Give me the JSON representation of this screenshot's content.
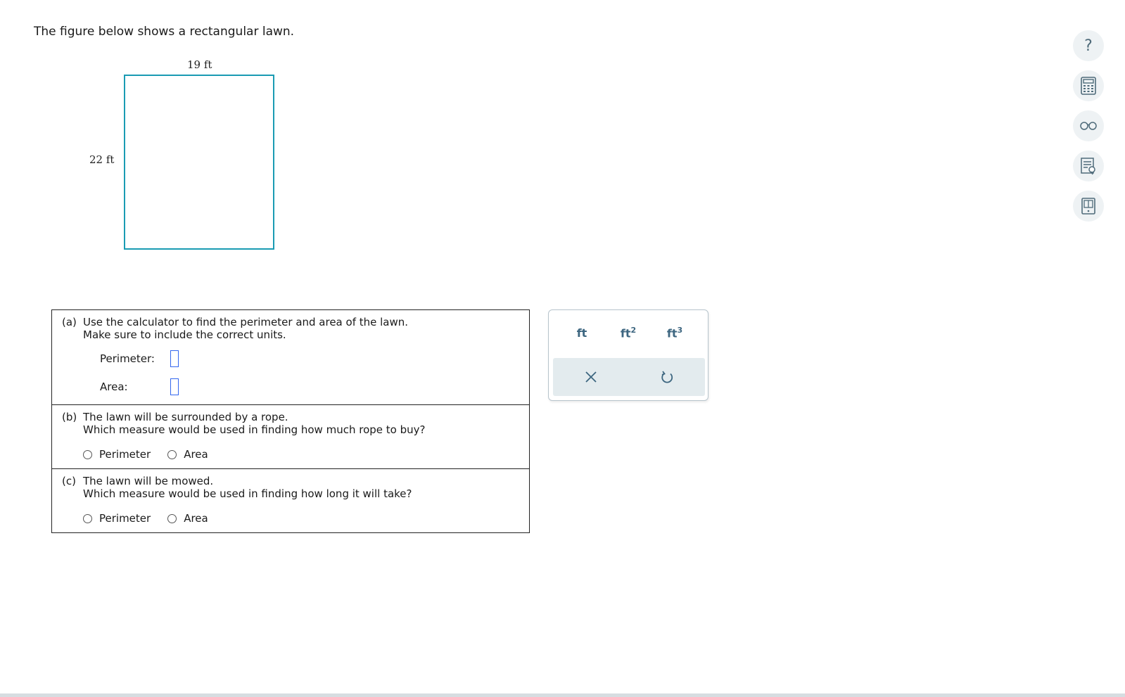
{
  "intro_text": "The figure below shows a rectangular lawn.",
  "figure": {
    "width_label": "19 ft",
    "height_label": "22 ft",
    "border_color": "#1a9bb3"
  },
  "part_a": {
    "label": "(a)",
    "line1": "Use the calculator to find the perimeter and area of the lawn.",
    "line2": "Make sure to include the correct units.",
    "perimeter_label": "Perimeter:",
    "perimeter_value": "",
    "area_label": "Area:",
    "area_value": ""
  },
  "part_b": {
    "label": "(b)",
    "line1": "The lawn will be surrounded by a rope.",
    "line2": "Which measure would be used in finding how much rope to buy?",
    "option1": "Perimeter",
    "option2": "Area"
  },
  "part_c": {
    "label": "(c)",
    "line1": "The lawn will be mowed.",
    "line2": "Which measure would be used in finding how long it will take?",
    "option1": "Perimeter",
    "option2": "Area"
  },
  "units_palette": {
    "unit1": "ft",
    "unit2_base": "ft",
    "unit2_sup": "2",
    "unit3_base": "ft",
    "unit3_sup": "3",
    "clear_icon": "close-icon",
    "undo_icon": "undo-icon"
  },
  "tools": {
    "help_glyph": "?",
    "icons": [
      "help-icon",
      "calculator-icon",
      "glasses-icon",
      "notes-icon",
      "reference-book-icon"
    ]
  },
  "colors": {
    "answer_box_border": "#3366ee",
    "unit_text": "#3d6680",
    "action_row_bg": "#e3ebee"
  }
}
